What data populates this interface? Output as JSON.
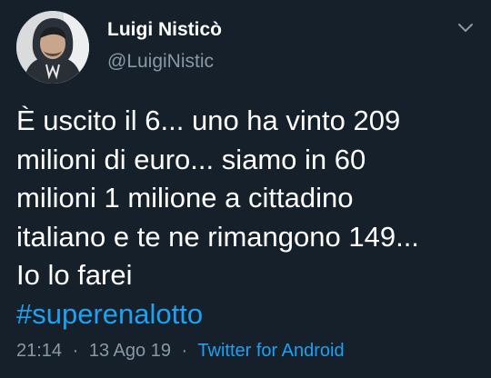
{
  "colors": {
    "background": "#15202b",
    "primary_text": "#ffffff",
    "secondary_text": "#8899a6",
    "accent": "#1da1f2"
  },
  "author": {
    "display_name": "Luigi Nisticò",
    "handle": "@LuigiNistic",
    "avatar_icon": "profile-photo"
  },
  "tweet": {
    "text_lines": [
      "È uscito il 6... uno ha vinto 209",
      "milioni di euro... siamo in 60",
      "milioni 1 milione a cittadino",
      "italiano e te ne rimangono 149...",
      "Io lo farei"
    ],
    "hashtag": "#superenalotto"
  },
  "meta": {
    "time": "21:14",
    "separator_1": "·",
    "date": "13 Ago 19",
    "separator_2": "·",
    "source": "Twitter for Android"
  },
  "icons": {
    "menu": "chevron-down-icon"
  }
}
